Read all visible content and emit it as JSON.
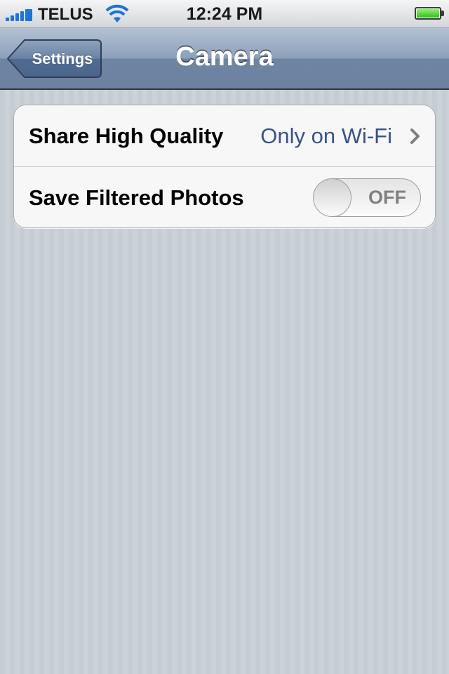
{
  "status_bar": {
    "carrier": "TELUS",
    "time": "12:24 PM",
    "icons": [
      "signal-bars-icon",
      "wifi-icon",
      "battery-icon"
    ],
    "battery_level": 1.0,
    "signal_color": "#1c73d9"
  },
  "nav": {
    "back_label": "Settings",
    "title": "Camera"
  },
  "settings": {
    "rows": [
      {
        "label": "Share High Quality",
        "value": "Only on Wi-Fi",
        "accessory": "chevron-right-icon"
      },
      {
        "label": "Save Filtered Photos",
        "toggle": "OFF",
        "toggle_on": false
      }
    ]
  },
  "colors": {
    "value_text": "#385487",
    "background": "#c5ccd4"
  }
}
